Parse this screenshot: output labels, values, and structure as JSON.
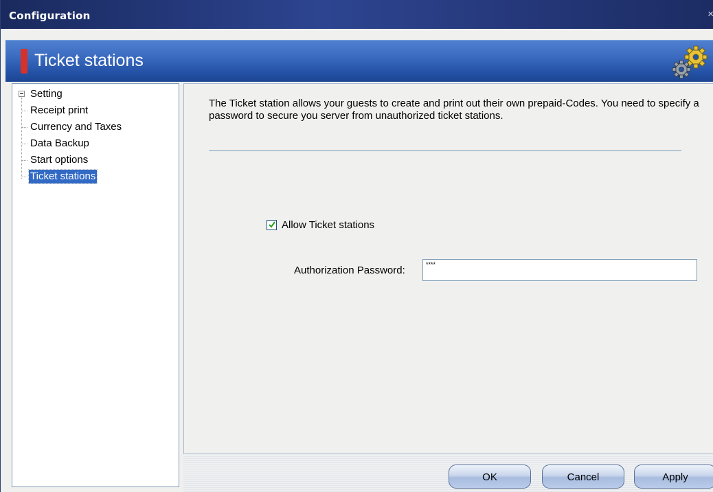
{
  "window": {
    "title": "Configuration",
    "close": "×"
  },
  "header": {
    "title": "Ticket stations",
    "icon": "gears-icon"
  },
  "tree": {
    "root": "Setting",
    "items": [
      {
        "label": "Receipt print",
        "selected": false
      },
      {
        "label": "Currency and Taxes",
        "selected": false
      },
      {
        "label": "Data Backup",
        "selected": false
      },
      {
        "label": "Start options",
        "selected": false
      },
      {
        "label": "Ticket stations",
        "selected": true
      }
    ]
  },
  "content": {
    "description": "The Ticket station allows your guests to create and print out their own prepaid-Codes. You need to specify a password to secure you server from unauthorized ticket stations.",
    "allow_label": "Allow Ticket stations",
    "allow_checked": true,
    "password_label": "Authorization Password:",
    "password_value": "****"
  },
  "buttons": {
    "ok": "OK",
    "cancel": "Cancel",
    "apply": "Apply"
  },
  "colors": {
    "header_blue": "#3a6bc0",
    "marker_red": "#d6312b",
    "selection": "#316ac5"
  }
}
